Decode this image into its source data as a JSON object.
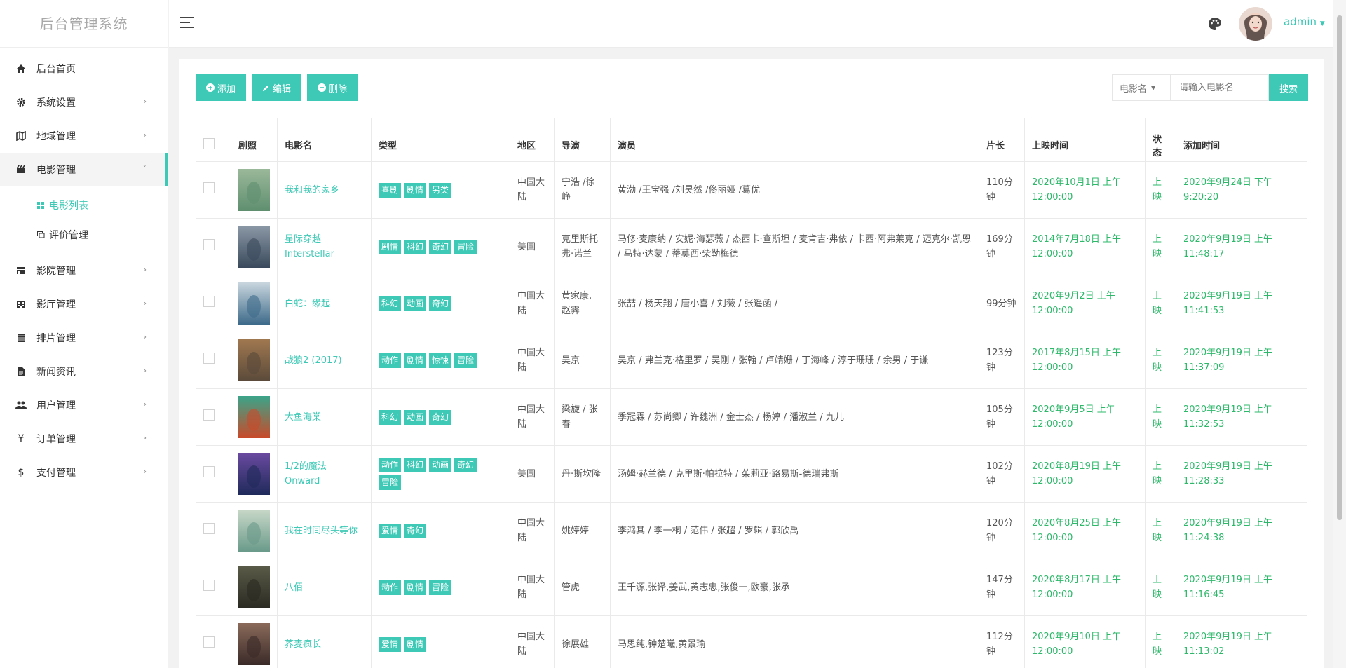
{
  "brand": "后台管理系统",
  "sidebar": {
    "items": [
      {
        "label": "后台首页",
        "icon": "home-icon",
        "has_children": false
      },
      {
        "label": "系统设置",
        "icon": "gear-icon",
        "has_children": true
      },
      {
        "label": "地域管理",
        "icon": "map-icon",
        "has_children": true
      },
      {
        "label": "电影管理",
        "icon": "film-icon",
        "has_children": true,
        "expanded": true,
        "children": [
          {
            "label": "电影列表",
            "icon": "grid-icon",
            "active": true
          },
          {
            "label": "评价管理",
            "icon": "comment-icon",
            "active": false
          }
        ]
      },
      {
        "label": "影院管理",
        "icon": "cinema-icon",
        "has_children": true
      },
      {
        "label": "影厅管理",
        "icon": "building-icon",
        "has_children": true
      },
      {
        "label": "排片管理",
        "icon": "schedule-icon",
        "has_children": true
      },
      {
        "label": "新闻资讯",
        "icon": "news-icon",
        "has_children": true
      },
      {
        "label": "用户管理",
        "icon": "users-icon",
        "has_children": true
      },
      {
        "label": "订单管理",
        "icon": "yen-icon",
        "has_children": true
      },
      {
        "label": "支付管理",
        "icon": "dollar-icon",
        "has_children": true
      }
    ]
  },
  "header": {
    "username": "admin"
  },
  "toolbar": {
    "add": "添加",
    "edit": "编辑",
    "delete": "删除"
  },
  "search": {
    "field": "电影名",
    "placeholder": "请输入电影名",
    "button": "搜索"
  },
  "table": {
    "headers": [
      "",
      "剧照",
      "电影名",
      "类型",
      "地区",
      "导演",
      "演员",
      "片长",
      "上映时间",
      "状态",
      "添加时间"
    ],
    "rows": [
      {
        "title": "我和我的家乡",
        "tags": [
          "喜剧",
          "剧情",
          "另类"
        ],
        "region": "中国大陆",
        "director": "宁浩 /徐峥",
        "actors": "黄渤 /王宝强 /刘昊然 /佟丽娅 /葛优",
        "duration": "110分钟",
        "release": "2020年10月1日 上午12:00:00",
        "status": "上映",
        "added": "2020年9月24日 下午9:20:20",
        "poster": [
          "#5f8f6f",
          "#9bb89a"
        ]
      },
      {
        "title": "星际穿越 Interstellar",
        "tags": [
          "剧情",
          "科幻",
          "奇幻",
          "冒险"
        ],
        "region": "美国",
        "director": "克里斯托弗·诺兰",
        "actors": "马修·麦康纳 / 安妮·海瑟薇 / 杰西卡·查斯坦 / 麦肯吉·弗依 / 卡西·阿弗莱克 / 迈克尔·凯恩 / 马特·达蒙 / 蒂莫西·柴勒梅德",
        "duration": "169分钟",
        "release": "2014年7月18日 上午12:00:00",
        "status": "上映",
        "added": "2020年9月19日 上午11:48:17",
        "poster": [
          "#3a4a5c",
          "#8b98a6"
        ]
      },
      {
        "title": "白蛇：缘起",
        "tags": [
          "科幻",
          "动画",
          "奇幻"
        ],
        "region": "中国大陆",
        "director": "黄家康, 赵霁",
        "actors": "张喆 / 杨天翔 / 唐小喜 / 刘薇 / 张遥函 /",
        "duration": "99分钟",
        "release": "2020年9月2日 上午12:00:00",
        "status": "上映",
        "added": "2020年9月19日 上午11:41:53",
        "poster": [
          "#3d6a8a",
          "#c9d6de"
        ]
      },
      {
        "title": "战狼2 (2017)",
        "tags": [
          "动作",
          "剧情",
          "惊悚",
          "冒险"
        ],
        "region": "中国大陆",
        "director": "吴京",
        "actors": "吴京 / 弗兰克·格里罗 / 吴刚 / 张翰 / 卢靖姗 / 丁海峰 / 淳于珊珊 / 余男 / 于谦",
        "duration": "123分钟",
        "release": "2017年8月15日 上午12:00:00",
        "status": "上映",
        "added": "2020年9月19日 上午11:37:09",
        "poster": [
          "#5a4a3a",
          "#a07850"
        ]
      },
      {
        "title": "大鱼海棠",
        "tags": [
          "科幻",
          "动画",
          "奇幻"
        ],
        "region": "中国大陆",
        "director": "梁旋 / 张春",
        "actors": "季冠霖 / 苏尚卿 / 许魏洲 / 金士杰 / 杨婷 / 潘淑兰 / 九儿",
        "duration": "105分钟",
        "release": "2020年9月5日 上午12:00:00",
        "status": "上映",
        "added": "2020年9月19日 上午11:32:53",
        "poster": [
          "#c94a2a",
          "#3aa58a"
        ]
      },
      {
        "title": "1/2的魔法 Onward",
        "tags": [
          "动作",
          "科幻",
          "动画",
          "奇幻",
          "冒险"
        ],
        "region": "美国",
        "director": "丹·斯坎隆",
        "actors": "汤姆·赫兰德 / 克里斯·帕拉特 / 茱莉亚·路易斯-德瑞弗斯",
        "duration": "102分钟",
        "release": "2020年8月19日 上午12:00:00",
        "status": "上映",
        "added": "2020年9月19日 上午11:28:33",
        "poster": [
          "#1f2a5a",
          "#6a4aa0"
        ]
      },
      {
        "title": "我在时间尽头等你",
        "tags": [
          "爱情",
          "奇幻"
        ],
        "region": "中国大陆",
        "director": "姚婷婷",
        "actors": "李鸿其 / 李一桐 / 范伟 / 张超 / 罗辑 / 郭欣禹",
        "duration": "120分钟",
        "release": "2020年8月25日 上午12:00:00",
        "status": "上映",
        "added": "2020年9月19日 上午11:24:38",
        "poster": [
          "#6a9a8a",
          "#c8d8c8"
        ]
      },
      {
        "title": "八佰",
        "tags": [
          "动作",
          "剧情",
          "冒险"
        ],
        "region": "中国大陆",
        "director": "管虎",
        "actors": "王千源,张译,姜武,黄志忠,张俊一,欧豪,张承",
        "duration": "147分钟",
        "release": "2020年8月17日 上午12:00:00",
        "status": "上映",
        "added": "2020年9月19日 上午11:16:45",
        "poster": [
          "#2a2a22",
          "#5a5a48"
        ]
      },
      {
        "title": "荞麦疯长",
        "tags": [
          "爱情",
          "剧情"
        ],
        "region": "中国大陆",
        "director": "徐展雄",
        "actors": "马思纯,钟楚曦,黄景瑜",
        "duration": "112分钟",
        "release": "2020年9月10日 上午12:00:00",
        "status": "上映",
        "added": "2020年9月19日 上午11:13:02",
        "poster": [
          "#3a2a28",
          "#8a6a5a"
        ]
      }
    ]
  }
}
